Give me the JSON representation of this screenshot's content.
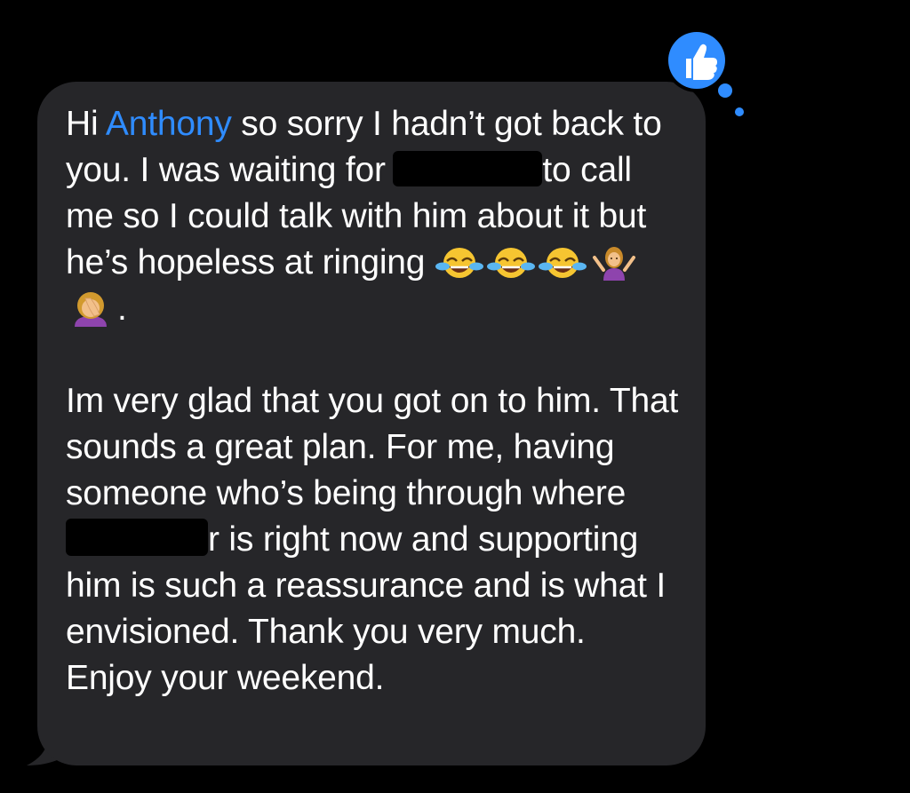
{
  "message": {
    "greeting": "Hi ",
    "mention": "Anthony",
    "line1_rest": " so sorry I hadn’t got back to you. I was waiting for ",
    "line2_after_redaction": "to call me so I could talk with him about it but he’s hopeless at ringing ",
    "end_punct": ".",
    "para2_start": "Im very glad that you got on to him. That sounds a great plan.  For me, having someone who’s being through where ",
    "para2_after_redaction": "r is right now and supporting him is such a reassurance and is what I envisioned. Thank you very much. Enjoy your weekend."
  },
  "emojis": [
    "tears-of-joy-emoji",
    "tears-of-joy-emoji",
    "tears-of-joy-emoji",
    "shrugging-woman-emoji",
    "facepalm-woman-emoji"
  ],
  "tapback": {
    "reaction": "thumbs-up",
    "color": "#2f8cff"
  },
  "colors": {
    "background": "#000000",
    "bubble": "#262629",
    "text": "#ffffff",
    "mention": "#2f8cff"
  }
}
